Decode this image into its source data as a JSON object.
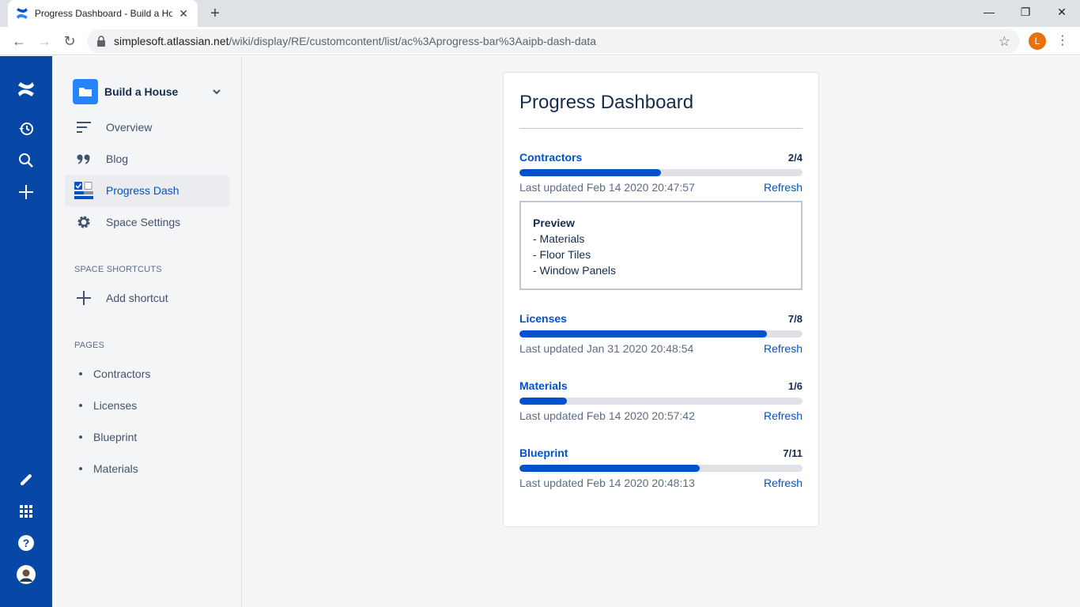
{
  "browser": {
    "tab_title": "Progress Dashboard - Build a House",
    "url_host": "simplesoft.atlassian.net",
    "url_path": "/wiki/display/RE/customcontent/list/ac%3Aprogress-bar%3Aaipb-dash-data",
    "profile_initial": "L"
  },
  "sidebar": {
    "space_name": "Build a House",
    "nav": [
      {
        "label": "Overview"
      },
      {
        "label": "Blog"
      },
      {
        "label": "Progress Dash"
      },
      {
        "label": "Space Settings"
      }
    ],
    "shortcuts_label": "SPACE SHORTCUTS",
    "add_shortcut": "Add shortcut",
    "pages_label": "PAGES",
    "pages": [
      "Contractors",
      "Licenses",
      "Blueprint",
      "Materials"
    ]
  },
  "dashboard": {
    "title": "Progress Dashboard",
    "items": [
      {
        "name": "Contractors",
        "count": "2/4",
        "done": 2,
        "total": 4,
        "updated": "Last updated Feb 14 2020 20:47:57",
        "refresh": "Refresh"
      },
      {
        "name": "Licenses",
        "count": "7/8",
        "done": 7,
        "total": 8,
        "updated": "Last updated Jan 31 2020 20:48:54",
        "refresh": "Refresh"
      },
      {
        "name": "Materials",
        "count": "1/6",
        "done": 1,
        "total": 6,
        "updated": "Last updated Feb 14 2020 20:57:42",
        "refresh": "Refresh"
      },
      {
        "name": "Blueprint",
        "count": "7/11",
        "done": 7,
        "total": 11,
        "updated": "Last updated Feb 14 2020 20:48:13",
        "refresh": "Refresh"
      }
    ],
    "preview": {
      "title": "Preview",
      "lines": [
        "- Materials",
        "- Floor Tiles",
        "- Window Panels"
      ]
    }
  },
  "colors": {
    "accent": "#0052cc",
    "global_nav": "#0747a6"
  }
}
